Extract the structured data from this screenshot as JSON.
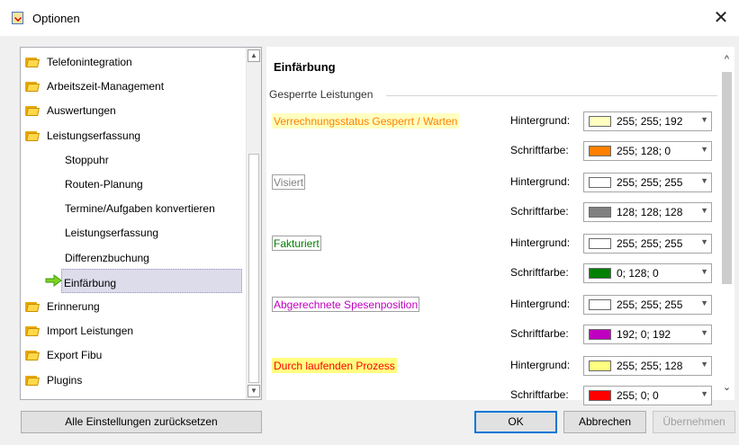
{
  "window": {
    "title": "Optionen",
    "close_glyph": "✕"
  },
  "tree": {
    "items": [
      {
        "label": "Telefonintegration",
        "icon": "folder-icon"
      },
      {
        "label": "Arbeitszeit-Management",
        "icon": "folder-icon"
      },
      {
        "label": "Auswertungen",
        "icon": "folder-icon"
      },
      {
        "label": "Leistungserfassung",
        "icon": "folder-icon"
      }
    ],
    "children": [
      {
        "label": "Stoppuhr"
      },
      {
        "label": "Routen-Planung"
      },
      {
        "label": "Termine/Aufgaben konvertieren"
      },
      {
        "label": "Leistungserfassung"
      },
      {
        "label": "Differenzbuchung"
      },
      {
        "label": "Einfärbung",
        "selected": true,
        "icon": "arrow-right-icon"
      }
    ],
    "items_after": [
      {
        "label": "Erinnerung",
        "icon": "folder-icon"
      },
      {
        "label": "Import Leistungen",
        "icon": "folder-icon"
      },
      {
        "label": "Export Fibu",
        "icon": "folder-icon"
      },
      {
        "label": "Plugins",
        "icon": "folder-icon"
      }
    ]
  },
  "panel": {
    "title": "Einfärbung",
    "group_title": "Gesperrte Leistungen",
    "rows": [
      {
        "sample": "Verrechnungsstatus Gesperrt / Warten",
        "sample_bg": "#ffffc0",
        "sample_fg": "#ff8000",
        "bg_label": "Hintergrund:",
        "bg_value": "255; 255; 192",
        "bg_color": "#ffffc0",
        "fg_label": "Schriftfarbe:",
        "fg_value": "255; 128; 0",
        "fg_color": "#ff8000"
      },
      {
        "sample": "Visiert",
        "sample_bg": "#ffffff",
        "sample_fg": "#808080",
        "bg_label": "Hintergrund:",
        "bg_value": "255; 255; 255",
        "bg_color": "#ffffff",
        "fg_label": "Schriftfarbe:",
        "fg_value": "128; 128; 128",
        "fg_color": "#808080"
      },
      {
        "sample": "Fakturiert",
        "sample_bg": "#ffffff",
        "sample_fg": "#008000",
        "bg_label": "Hintergrund:",
        "bg_value": "255; 255; 255",
        "bg_color": "#ffffff",
        "fg_label": "Schriftfarbe:",
        "fg_value": "0; 128; 0",
        "fg_color": "#008000"
      },
      {
        "sample": "Abgerechnete Spesenposition",
        "sample_bg": "#ffffff",
        "sample_fg": "#c000c0",
        "bg_label": "Hintergrund:",
        "bg_value": "255; 255; 255",
        "bg_color": "#ffffff",
        "fg_label": "Schriftfarbe:",
        "fg_value": "192; 0; 192",
        "fg_color": "#c000c0"
      },
      {
        "sample": "Durch laufenden Prozess",
        "sample_bg": "#ffff80",
        "sample_fg": "#ff0000",
        "bg_label": "Hintergrund:",
        "bg_value": "255; 255; 128",
        "bg_color": "#ffff80",
        "fg_label": "Schriftfarbe:",
        "fg_value": "255; 0; 0",
        "fg_color": "#ff0000"
      }
    ]
  },
  "buttons": {
    "reset": "Alle Einstellungen zurücksetzen",
    "ok": "OK",
    "cancel": "Abbrechen",
    "apply": "Übernehmen"
  }
}
